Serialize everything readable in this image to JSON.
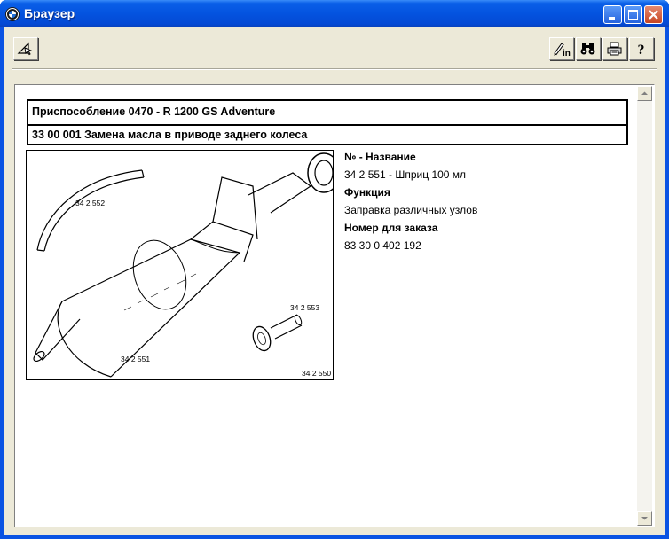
{
  "window": {
    "title": "Браузер"
  },
  "toolbar": {
    "left_icon": "navigation-icon",
    "right_icons": [
      "pen-info-icon",
      "binoculars-icon",
      "print-icon",
      "help-icon"
    ]
  },
  "document": {
    "header_line1": "Приспособление 0470 - R 1200 GS Adventure",
    "header_line2": "33 00 001 Замена масла в приводе заднего колеса",
    "figure_labels": {
      "hose": "34 2 552",
      "plug": "34 2 553",
      "syringe": "34 2 551",
      "figure_id": "34 2 550"
    },
    "info": {
      "number_title": "№ - Название",
      "number_value": "34 2 551 - Шприц 100 мл",
      "function_title": "Функция",
      "function_value": "Заправка различных узлов",
      "order_title": "Номер для заказа",
      "order_value": "83 30 0 402 192"
    }
  },
  "colors": {
    "titlebar": "#0453df",
    "client_bg": "#ece9d8",
    "close_button": "#c74522"
  }
}
